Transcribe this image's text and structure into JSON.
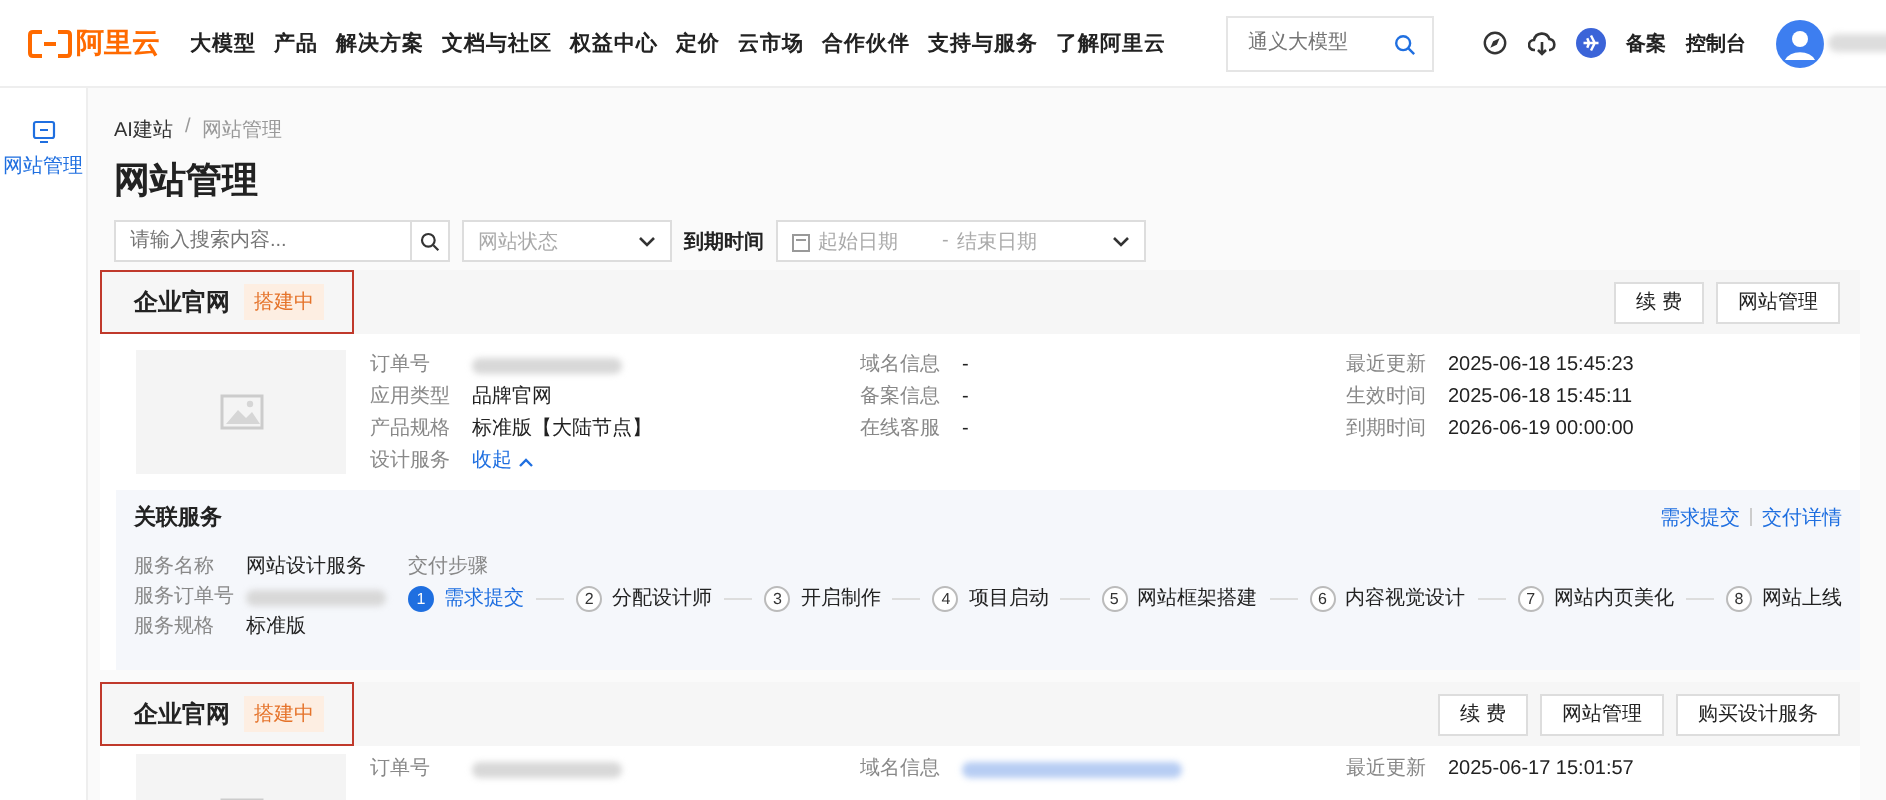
{
  "header": {
    "logo": "阿里云",
    "nav": [
      "大模型",
      "产品",
      "解决方案",
      "文档与社区",
      "权益中心",
      "定价",
      "云市场",
      "合作伙伴",
      "支持与服务",
      "了解阿里云"
    ],
    "search": {
      "placeholder": "通义大模型"
    },
    "links": [
      "备案",
      "控制台"
    ]
  },
  "sidebar": {
    "items": [
      {
        "label": "网站管理",
        "selected": true
      }
    ]
  },
  "breadcrumb": [
    "AI建站",
    "网站管理"
  ],
  "breadcrumb_separator": "/",
  "title": "网站管理",
  "filters": {
    "search": {
      "placeholder": "请输入搜索内容..."
    },
    "status": {
      "placeholder": "网站状态"
    },
    "expiry_label": "到期时间",
    "start": {
      "placeholder": "起始日期"
    },
    "separator": "-",
    "end": {
      "placeholder": "结束日期"
    }
  },
  "sites": [
    {
      "name": "企业官网",
      "status": "搭建中",
      "highlighted": true,
      "buttons": [
        "续 费",
        "网站管理"
      ],
      "thumbnail": true,
      "columns": [
        [
          {
            "label": "订单号",
            "kind": "redacted"
          },
          {
            "label": "应用类型",
            "kind": "text",
            "value": "品牌官网"
          },
          {
            "label": "产品规格",
            "kind": "text",
            "value": "标准版【大陆节点】"
          },
          {
            "label": "设计服务",
            "kind": "toggle",
            "value": "收起",
            "expanded": true
          }
        ],
        [
          {
            "label": "域名信息",
            "kind": "text",
            "value": "-"
          },
          {
            "label": "备案信息",
            "kind": "text",
            "value": "-"
          },
          {
            "label": "在线客服",
            "kind": "text",
            "value": "-"
          }
        ],
        [
          {
            "label": "最近更新",
            "kind": "text",
            "value": "2025-06-18 15:45:23"
          },
          {
            "label": "生效时间",
            "kind": "text",
            "value": "2025-06-18 15:45:11"
          },
          {
            "label": "到期时间",
            "kind": "text",
            "value": "2026-06-19 00:00:00"
          }
        ]
      ],
      "services": {
        "title": "关联服务",
        "links": [
          "需求提交",
          "交付详情"
        ],
        "fields": [
          {
            "label": "服务名称",
            "kind": "text",
            "value": "网站设计服务"
          },
          {
            "label": "服务订单号",
            "kind": "redacted"
          },
          {
            "label": "服务规格",
            "kind": "text",
            "value": "标准版"
          }
        ],
        "steps_label": "交付步骤",
        "steps": [
          {
            "number": "1",
            "label": "需求提交",
            "selected": true
          },
          {
            "number": "2",
            "label": "分配设计师",
            "selected": false
          },
          {
            "number": "3",
            "label": "开启制作",
            "selected": false
          },
          {
            "number": "4",
            "label": "项目启动",
            "selected": false
          },
          {
            "number": "5",
            "label": "网站框架搭建",
            "selected": false
          },
          {
            "number": "6",
            "label": "内容视觉设计",
            "selected": false
          },
          {
            "number": "7",
            "label": "网站内页美化",
            "selected": false
          },
          {
            "number": "8",
            "label": "网站上线",
            "selected": false
          }
        ]
      }
    },
    {
      "name": "企业官网",
      "status": "搭建中",
      "highlighted": true,
      "buttons": [
        "续 费",
        "网站管理",
        "购买设计服务"
      ],
      "thumbnail": true,
      "columns": [
        [
          {
            "label": "订单号",
            "kind": "redacted"
          }
        ],
        [
          {
            "label": "域名信息",
            "kind": "redacted_link"
          }
        ],
        [
          {
            "label": "最近更新",
            "kind": "text",
            "value": "2025-06-17 15:01:57"
          }
        ]
      ]
    }
  ]
}
